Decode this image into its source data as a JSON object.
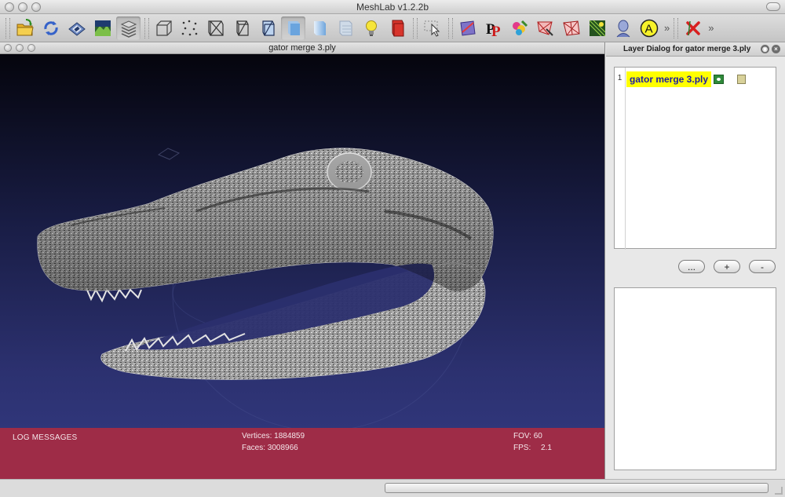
{
  "app": {
    "title": "MeshLab v1.2.2b"
  },
  "toolbar": {
    "buttons": [
      {
        "name": "open-folder-icon"
      },
      {
        "name": "reload-icon"
      },
      {
        "name": "save-icon"
      },
      {
        "name": "snapshot-icon"
      },
      {
        "name": "layers-icon",
        "active": true
      },
      {
        "name": "bounding-box-icon"
      },
      {
        "name": "points-icon"
      },
      {
        "name": "wireframe-icon"
      },
      {
        "name": "hidden-lines-icon"
      },
      {
        "name": "flat-lines-icon"
      },
      {
        "name": "flat-shading-icon",
        "active": true
      },
      {
        "name": "smooth-shading-icon"
      },
      {
        "name": "texture-icon"
      },
      {
        "name": "light-bulb-icon"
      },
      {
        "name": "backface-icon"
      },
      {
        "name": "select-faces-icon"
      },
      {
        "name": "measure-icon"
      },
      {
        "name": "pick-points-icon"
      },
      {
        "name": "paint-icon"
      },
      {
        "name": "align-icon"
      },
      {
        "name": "mesh-edit-icon"
      },
      {
        "name": "raster-icon"
      },
      {
        "name": "head-icon"
      },
      {
        "name": "annotation-icon"
      },
      {
        "name": "close-red-icon"
      }
    ],
    "overflow_label": "»"
  },
  "document": {
    "title": "gator merge 3.ply",
    "log": {
      "label": "LOG MESSAGES",
      "vertices_label": "Vertices: 1884859",
      "faces_label": "Faces: 3008966",
      "fov_label": "FOV: 60",
      "fps_label": "FPS:",
      "fps_value": "2.1"
    }
  },
  "layer_dialog": {
    "title": "Layer Dialog for gator merge 3.ply",
    "layers": [
      {
        "index": "1",
        "name": "gator merge 3.ply"
      }
    ],
    "buttons": {
      "more": "...",
      "add": "+",
      "remove": "-"
    }
  },
  "colors": {
    "log_bar": "#9e2c47",
    "layer_highlight": "#ffff00",
    "layer_text": "#1a1aa8"
  }
}
